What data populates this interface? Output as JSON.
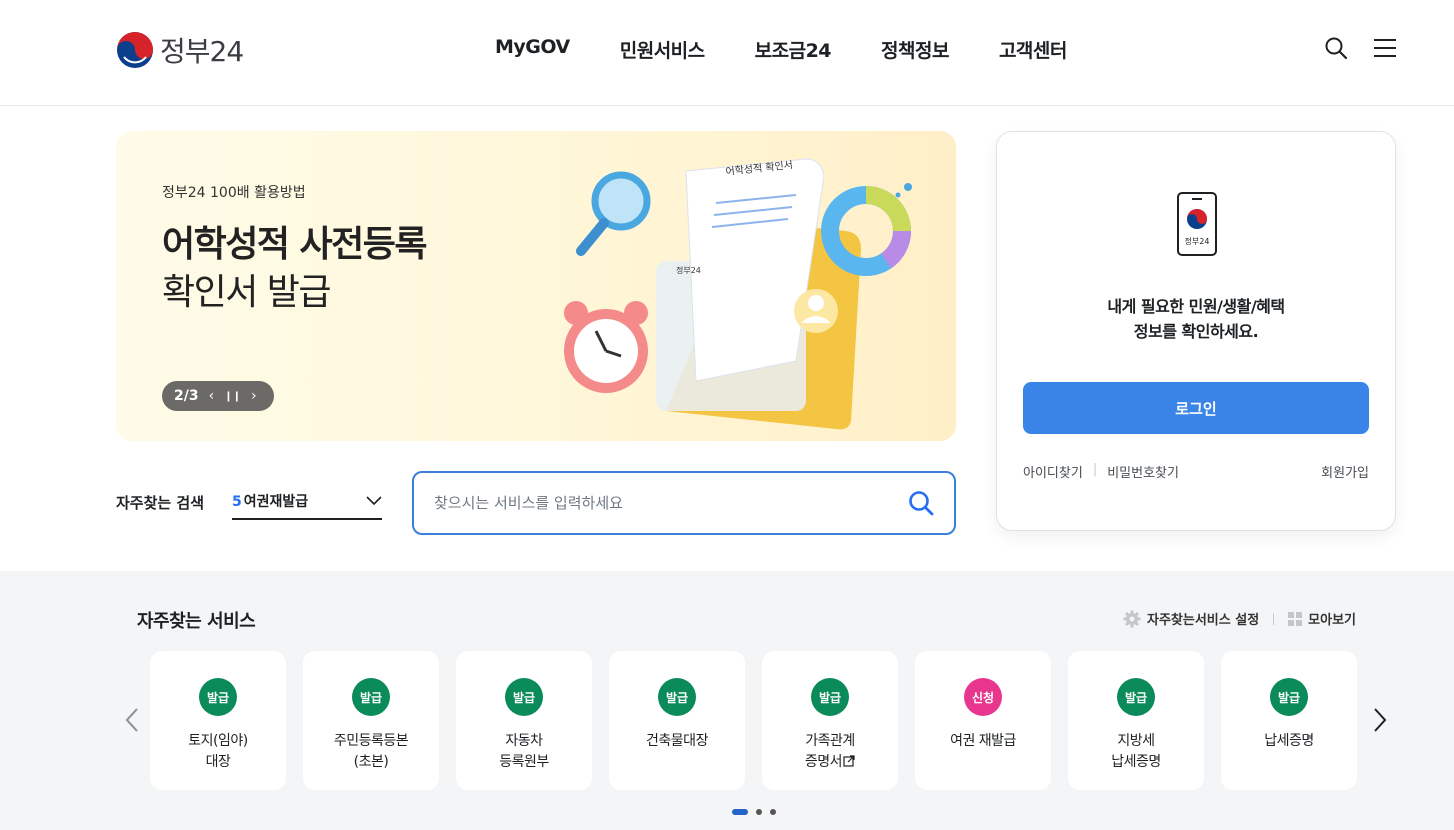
{
  "header": {
    "logo_text": "정부24",
    "nav": [
      "MyGOV",
      "민원서비스",
      "보조금24",
      "정책정보",
      "고객센터"
    ]
  },
  "banner": {
    "subtitle": "정부24 100배 활용방법",
    "title_line1": "어학성적 사전등록",
    "title_line2": "확인서 발급",
    "pager": "2/3",
    "doc_title": "어학성적 확인서",
    "doc_logo": "정부24"
  },
  "search": {
    "fav_label": "자주찾는 검색",
    "fav_rank": "5",
    "fav_value": "여권재발급",
    "placeholder": "찾으시는 서비스를 입력하세요"
  },
  "login": {
    "phone_logo": "정부24",
    "message_line1": "내게 필요한 민원/생활/혜택",
    "message_line2": "정보를 확인하세요.",
    "login_button": "로그인",
    "find_id": "아이디찾기",
    "find_pw": "비밀번호찾기",
    "join": "회원가입"
  },
  "services": {
    "title": "자주찾는 서비스",
    "settings": "자주찾는서비스 설정",
    "view_all": "모아보기",
    "items": [
      {
        "badge": "발급",
        "label": "토지(임야)\n대장"
      },
      {
        "badge": "발급",
        "label": "주민등록등본\n(초본)"
      },
      {
        "badge": "발급",
        "label": "자동차\n등록원부"
      },
      {
        "badge": "발급",
        "label": "건축물대장"
      },
      {
        "badge": "발급",
        "label": "가족관계\n증명서"
      },
      {
        "badge": "신청",
        "label": "여권 재발급"
      },
      {
        "badge": "발급",
        "label": "지방세\n납세증명"
      },
      {
        "badge": "발급",
        "label": "납세증명"
      }
    ]
  },
  "colors": {
    "accent": "#3a84e8",
    "badge_issue": "#0b8a5a",
    "badge_apply": "#e8368f"
  }
}
